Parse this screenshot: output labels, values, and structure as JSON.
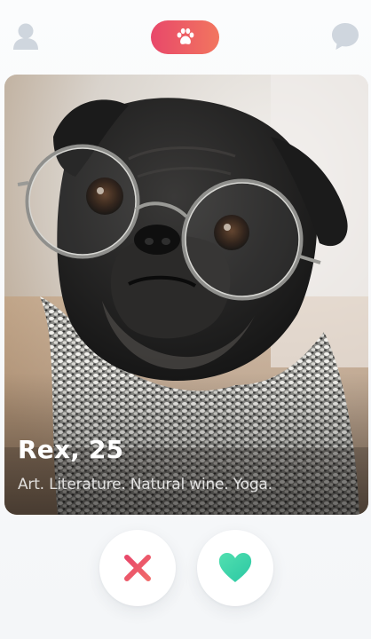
{
  "header": {
    "profile_icon": "user-icon",
    "brand_icon": "paw-icon",
    "chat_icon": "chat-bubble-icon",
    "brand_colors": [
      "#e8486a",
      "#f2765f"
    ],
    "icon_color": "#cfd6de"
  },
  "card": {
    "name_age": "Rex, 25",
    "bio": "Art. Literature. Natural wine. Yoga."
  },
  "actions": {
    "dislike_icon": "close-icon",
    "dislike_color": "#e8486a",
    "like_icon": "heart-icon",
    "like_color": "#3ed4a8"
  }
}
